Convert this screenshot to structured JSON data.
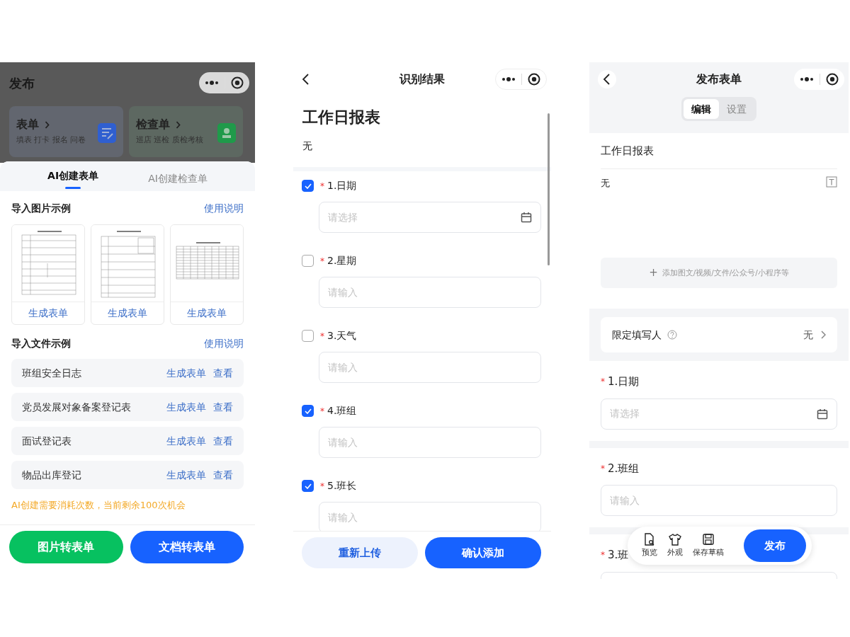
{
  "left": {
    "title": "发布",
    "cards": [
      {
        "title": "表单",
        "subtitle": "填表 打卡 报名 问卷",
        "color": "#2f5fd0"
      },
      {
        "title": "检查单",
        "subtitle": "巡店 巡检 质检考核",
        "color": "#1f9a4a"
      }
    ],
    "sheet_tabs": [
      {
        "label": "AI创建表单",
        "selected": true
      },
      {
        "label": "AI创建检查单",
        "selected": false
      }
    ],
    "image_section": {
      "heading": "导入图片示例",
      "help_link": "使用说明",
      "examples": [
        {
          "action": "生成表单"
        },
        {
          "action": "生成表单"
        },
        {
          "action": "生成表单"
        }
      ]
    },
    "file_section": {
      "heading": "导入文件示例",
      "help_link": "使用说明",
      "files": [
        {
          "name": "班组安全日志",
          "action": "生成表单",
          "view": "查看"
        },
        {
          "name": "党员发展对象备案登记表",
          "action": "生成表单",
          "view": "查看"
        },
        {
          "name": "面试登记表",
          "action": "生成表单",
          "view": "查看"
        },
        {
          "name": "物品出库登记",
          "action": "生成表单",
          "view": "查看"
        }
      ]
    },
    "quota_note": "AI创建需要消耗次数，当前剩余100次机会",
    "buttons": [
      {
        "label": "图片转表单",
        "color": "#07c160"
      },
      {
        "label": "文档转表单",
        "color": "#1762ff"
      }
    ]
  },
  "middle": {
    "title": "识别结果",
    "form_title": "工作日报表",
    "description": "无",
    "fields": [
      {
        "required_mark": "*",
        "label": "1.日期",
        "checked": true,
        "kind": "date",
        "placeholder": "请选择"
      },
      {
        "required_mark": "*",
        "label": "2.星期",
        "checked": false,
        "kind": "text",
        "placeholder": "请输入"
      },
      {
        "required_mark": "*",
        "label": "3.天气",
        "checked": false,
        "kind": "text",
        "placeholder": "请输入"
      },
      {
        "required_mark": "*",
        "label": "4.班组",
        "checked": true,
        "kind": "text",
        "placeholder": "请输入"
      },
      {
        "required_mark": "*",
        "label": "5.班长",
        "checked": true,
        "kind": "text",
        "placeholder": "请输入"
      }
    ],
    "buttons": [
      {
        "label": "重新上传",
        "kind": "secondary"
      },
      {
        "label": "确认添加",
        "kind": "primary"
      }
    ]
  },
  "right": {
    "title": "发布表单",
    "tabs": [
      {
        "label": "编辑",
        "selected": true
      },
      {
        "label": "设置",
        "selected": false
      }
    ],
    "form_title": "工作日报表",
    "description": "无",
    "add_media": {
      "icon": "+",
      "label": "添加图文/视频/文件/公众号/小程序等"
    },
    "restrict": {
      "label": "限定填写人",
      "value": "无"
    },
    "fields": [
      {
        "required_mark": "*",
        "label": "1.日期",
        "kind": "date",
        "placeholder": "请选择"
      },
      {
        "required_mark": "*",
        "label": "2.班组",
        "kind": "text",
        "placeholder": "请输入"
      },
      {
        "required_mark": "*",
        "label": "3.班",
        "kind": "text"
      }
    ],
    "toolbar": {
      "actions": [
        {
          "label": "预览",
          "kind": "preview"
        },
        {
          "label": "外观",
          "kind": "appearance"
        },
        {
          "label": "保存草稿",
          "kind": "save"
        }
      ],
      "publish": "发布"
    }
  }
}
